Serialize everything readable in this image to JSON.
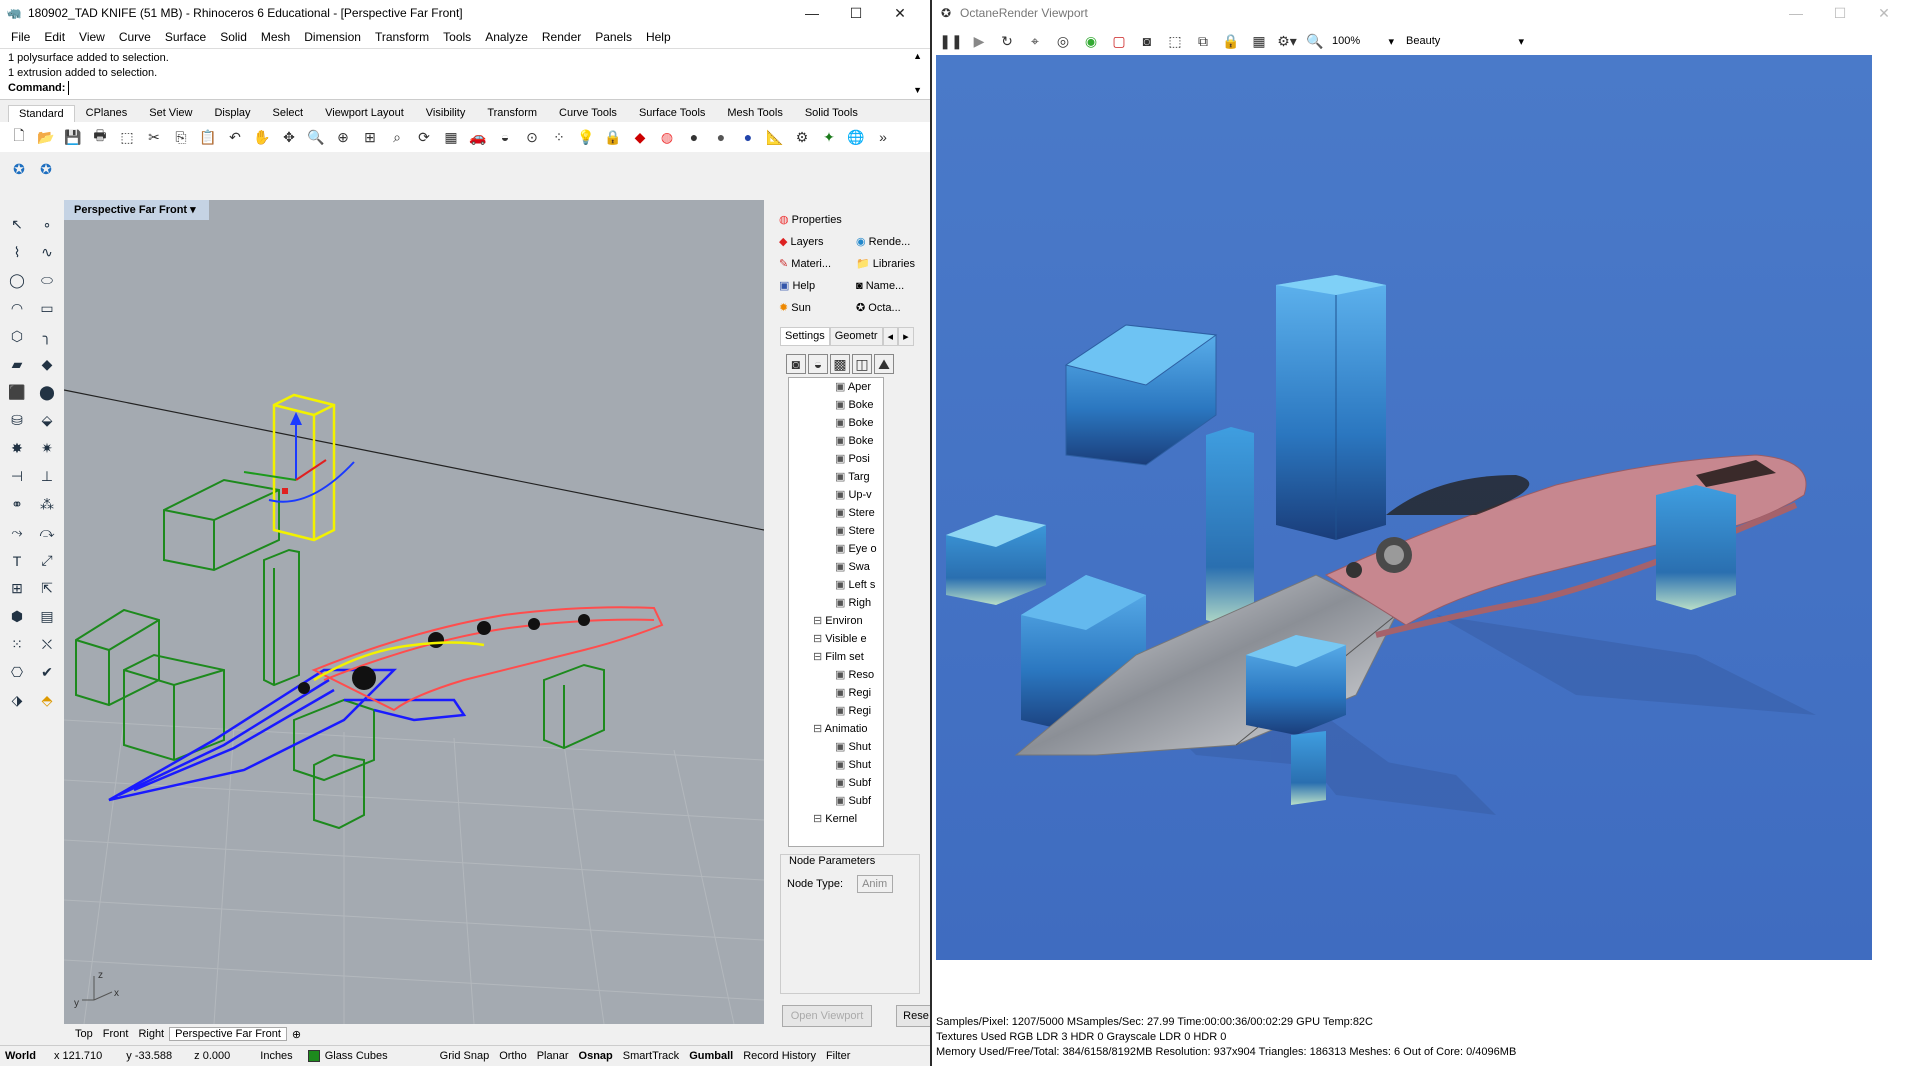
{
  "rhino": {
    "title": "180902_TAD KNIFE (51 MB) - Rhinoceros 6 Educational - [Perspective Far Front]",
    "menu": [
      "File",
      "Edit",
      "View",
      "Curve",
      "Surface",
      "Solid",
      "Mesh",
      "Dimension",
      "Transform",
      "Tools",
      "Analyze",
      "Render",
      "Panels",
      "Help"
    ],
    "history": [
      "1 polysurface added to selection.",
      "1 extrusion added to selection."
    ],
    "command_label": "Command:",
    "toolbar_tabs": [
      "Standard",
      "CPlanes",
      "Set View",
      "Display",
      "Select",
      "Viewport Layout",
      "Visibility",
      "Transform",
      "Curve Tools",
      "Surface Tools",
      "Mesh Tools",
      "Solid Tools"
    ],
    "viewport_title": "Perspective Far Front",
    "viewport_tabs": [
      "Top",
      "Front",
      "Right",
      "Perspective Far Front"
    ],
    "status": {
      "world": "World",
      "x": "x 121.710",
      "y": "y -33.588",
      "z": "z 0.000",
      "units": "Inches",
      "layer": "Glass Cubes",
      "toggles": [
        "Grid Snap",
        "Ortho",
        "Planar",
        "Osnap",
        "SmartTrack",
        "Gumball",
        "Record History",
        "Filter"
      ],
      "bold_toggles": [
        "Osnap",
        "Gumball"
      ]
    },
    "panel": {
      "tabs": [
        "Properties",
        "Layers",
        "Rende...",
        "Materi...",
        "Libraries",
        "Help",
        "Name...",
        "Sun",
        "Octa..."
      ],
      "subtabs": [
        "Settings",
        "Geometr"
      ],
      "tree": [
        {
          "label": "Aper",
          "indent": 3
        },
        {
          "label": "Boke",
          "indent": 3
        },
        {
          "label": "Boke",
          "indent": 3
        },
        {
          "label": "Boke",
          "indent": 3
        },
        {
          "label": "Posi",
          "indent": 3
        },
        {
          "label": "Targ",
          "indent": 3
        },
        {
          "label": "Up-v",
          "indent": 3
        },
        {
          "label": "Stere",
          "indent": 3
        },
        {
          "label": "Stere",
          "indent": 3
        },
        {
          "label": "Eye o",
          "indent": 3
        },
        {
          "label": "Swa",
          "indent": 3
        },
        {
          "label": "Left s",
          "indent": 3
        },
        {
          "label": "Righ",
          "indent": 3
        },
        {
          "label": "Environ",
          "indent": 2
        },
        {
          "label": "Visible e",
          "indent": 2
        },
        {
          "label": "Film set",
          "indent": 2
        },
        {
          "label": "Reso",
          "indent": 3
        },
        {
          "label": "Regi",
          "indent": 3
        },
        {
          "label": "Regi",
          "indent": 3
        },
        {
          "label": "Animatio",
          "indent": 2
        },
        {
          "label": "Shut",
          "indent": 3
        },
        {
          "label": "Shut",
          "indent": 3
        },
        {
          "label": "Subf",
          "indent": 3
        },
        {
          "label": "Subf",
          "indent": 3
        },
        {
          "label": "Kernel",
          "indent": 2
        }
      ],
      "node_params_label": "Node Parameters",
      "node_type_label": "Node Type:",
      "node_type_value": "Anim",
      "open_viewport": "Open Viewport",
      "reset": "Rese"
    }
  },
  "octane": {
    "title": "OctaneRender Viewport",
    "zoom": "100%",
    "pass": "Beauty",
    "stats": [
      "Samples/Pixel: 1207/5000  MSamples/Sec: 27.99  Time:00:00:36/00:02:29  GPU Temp:82C",
      "Textures Used RGB LDR 3  HDR 0  Grayscale LDR 0  HDR 0",
      "Memory Used/Free/Total: 384/6158/8192MB  Resolution: 937x904  Triangles: 186313  Meshes: 6 Out of Core: 0/4096MB"
    ]
  },
  "colors": {
    "render_bg": "#4f7fcf",
    "viewport_bg": "#a4aab1",
    "cube_green": "#1d8a1d",
    "blade_blue": "#1a1aff",
    "handle_red": "#ff3b3b",
    "select_yellow": "#f2f200",
    "glass_layer": "#1d8a1d"
  }
}
